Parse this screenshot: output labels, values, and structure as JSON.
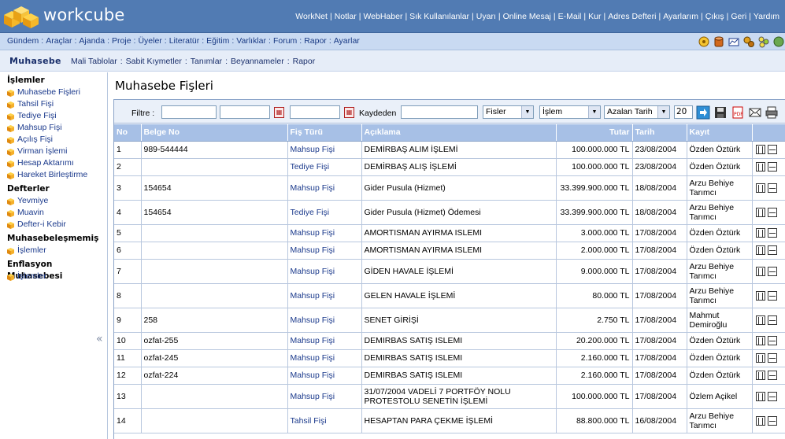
{
  "brand": {
    "name": "workcube"
  },
  "top_links": [
    "WorkNet",
    "Notlar",
    "WebHaber",
    "Sık Kullanılanlar",
    "Uyarı",
    "Online Mesaj",
    "E-Mail",
    "Kur",
    "Adres Defteri",
    "Ayarlarım",
    "Çıkış",
    "Geri",
    "Yardım"
  ],
  "nav_links": [
    "Gündem",
    "Araçlar",
    "Ajanda",
    "Proje",
    "Üyeler",
    "Literatür",
    "Eğitim",
    "Varlıklar",
    "Forum",
    "Rapor",
    "Ayarlar"
  ],
  "nav_icons": [
    "star-circle-icon",
    "cylinder-icon",
    "chart-icon",
    "gears-icon",
    "people-icon",
    "phone-icon"
  ],
  "module": {
    "title": "Muhasebe",
    "links": [
      "Mali Tablolar",
      "Sabit Kıymetler",
      "Tanımlar",
      "Beyannameler",
      "Rapor"
    ]
  },
  "sidebar": {
    "sections": [
      {
        "title": "İşlemler",
        "items": [
          "Muhasebe Fişleri",
          "Tahsil Fişi",
          "Tediye Fişi",
          "Mahsup Fişi",
          "Açılış Fişi",
          "Virman İşlemi",
          "Hesap Aktarımı",
          "Hareket Birleştirme"
        ]
      },
      {
        "title": "Defterler",
        "items": [
          "Yevmiye",
          "Muavin",
          "Defter-i Kebir"
        ]
      },
      {
        "title": "Muhasebeleşmemiş",
        "items": [
          "İşlemler"
        ]
      },
      {
        "title": "Enflasyon Muhasebesi",
        "items": [
          "İşlemler"
        ]
      }
    ],
    "collapse_glyph": "«"
  },
  "page": {
    "title": "Muhasebe Fişleri"
  },
  "filter": {
    "filtre_label": "Filtre :",
    "kaydeden_label": "Kaydeden",
    "doc_type_select": "Fisler",
    "process_select": "İşlem",
    "sort_select": "Azalan Tarih",
    "page_size": "20"
  },
  "columns": [
    "No",
    "Belge No",
    "Fiş Türü",
    "Açıklama",
    "Tutar",
    "Tarih",
    "Kayıt",
    ""
  ],
  "rows": [
    {
      "no": "1",
      "belge": "989-544444",
      "tur": "Mahsup Fişi",
      "aciklama": "DEMİRBAŞ ALIM İŞLEMİ",
      "tutar": "100.000.000 TL",
      "tarih": "23/08/2004",
      "kayit": "Özden Öztürk"
    },
    {
      "no": "2",
      "belge": "",
      "tur": "Tediye Fişi",
      "aciklama": "DEMİRBAŞ ALIŞ İŞLEMİ",
      "tutar": "100.000.000 TL",
      "tarih": "23/08/2004",
      "kayit": "Özden Öztürk"
    },
    {
      "no": "3",
      "belge": "154654",
      "tur": "Mahsup Fişi",
      "aciklama": "Gider Pusula (Hizmet)",
      "tutar": "33.399.900.000 TL",
      "tarih": "18/08/2004",
      "kayit": "Arzu Behiye Tarımcı"
    },
    {
      "no": "4",
      "belge": "154654",
      "tur": "Tediye Fişi",
      "aciklama": "Gider Pusula (Hizmet) Ödemesi",
      "tutar": "33.399.900.000 TL",
      "tarih": "18/08/2004",
      "kayit": "Arzu Behiye Tarımcı"
    },
    {
      "no": "5",
      "belge": "",
      "tur": "Mahsup Fişi",
      "aciklama": "AMORTISMAN AYIRMA ISLEMI",
      "tutar": "3.000.000 TL",
      "tarih": "17/08/2004",
      "kayit": "Özden Öztürk"
    },
    {
      "no": "6",
      "belge": "",
      "tur": "Mahsup Fişi",
      "aciklama": "AMORTISMAN AYIRMA ISLEMI",
      "tutar": "2.000.000 TL",
      "tarih": "17/08/2004",
      "kayit": "Özden Öztürk"
    },
    {
      "no": "7",
      "belge": "",
      "tur": "Mahsup Fişi",
      "aciklama": "GİDEN HAVALE İŞLEMİ",
      "tutar": "9.000.000 TL",
      "tarih": "17/08/2004",
      "kayit": "Arzu Behiye Tarımcı"
    },
    {
      "no": "8",
      "belge": "",
      "tur": "Mahsup Fişi",
      "aciklama": "GELEN HAVALE İŞLEMİ",
      "tutar": "80.000 TL",
      "tarih": "17/08/2004",
      "kayit": "Arzu Behiye Tarımcı"
    },
    {
      "no": "9",
      "belge": "258",
      "tur": "Mahsup Fişi",
      "aciklama": "SENET GİRİŞİ",
      "tutar": "2.750 TL",
      "tarih": "17/08/2004",
      "kayit": "Mahmut Demiroğlu"
    },
    {
      "no": "10",
      "belge": "ozfat-255",
      "tur": "Mahsup Fişi",
      "aciklama": "DEMIRBAS SATIŞ ISLEMI",
      "tutar": "20.200.000 TL",
      "tarih": "17/08/2004",
      "kayit": "Özden Öztürk"
    },
    {
      "no": "11",
      "belge": "ozfat-245",
      "tur": "Mahsup Fişi",
      "aciklama": "DEMIRBAS SATIŞ ISLEMI",
      "tutar": "2.160.000 TL",
      "tarih": "17/08/2004",
      "kayit": "Özden Öztürk"
    },
    {
      "no": "12",
      "belge": "ozfat-224",
      "tur": "Mahsup Fişi",
      "aciklama": "DEMIRBAS SATIŞ ISLEMI",
      "tutar": "2.160.000 TL",
      "tarih": "17/08/2004",
      "kayit": "Özden Öztürk"
    },
    {
      "no": "13",
      "belge": "",
      "tur": "Mahsup Fişi",
      "aciklama": "31/07/2004 VADELİ 7 PORTFÖY NOLU PROTESTOLU SENETİN İŞLEMİ",
      "tutar": "100.000.000 TL",
      "tarih": "17/08/2004",
      "kayit": "Özlem Açikel"
    },
    {
      "no": "14",
      "belge": "",
      "tur": "Tahsil Fişi",
      "aciklama": "HESAPTAN PARA ÇEKME İŞLEMİ",
      "tutar": "88.800.000 TL",
      "tarih": "16/08/2004",
      "kayit": "Arzu Behiye Tarımcı"
    }
  ],
  "colors": {
    "topbar": "#517bb3",
    "navbar": "#c9daf2",
    "header_row": "#a7c0e6",
    "link": "#1b3a8c"
  }
}
